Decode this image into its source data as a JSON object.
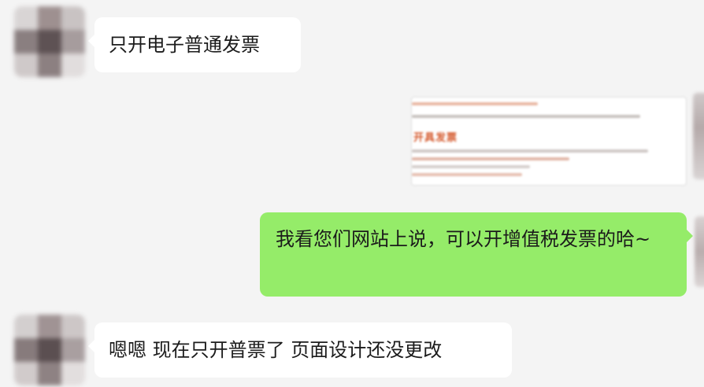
{
  "messages": [
    {
      "side": "left",
      "text": "只开电子普通发票"
    },
    {
      "side": "right",
      "type": "image",
      "caption": "开具发票"
    },
    {
      "side": "right",
      "text": "我看您们网站上说，可以开增值税发票的哈~"
    },
    {
      "side": "left",
      "text": "嗯嗯 现在只开普票了 页面设计还没更改"
    }
  ],
  "colors": {
    "background": "#f4f4f4",
    "incoming_bubble": "#ffffff",
    "outgoing_bubble": "#95ec69"
  }
}
